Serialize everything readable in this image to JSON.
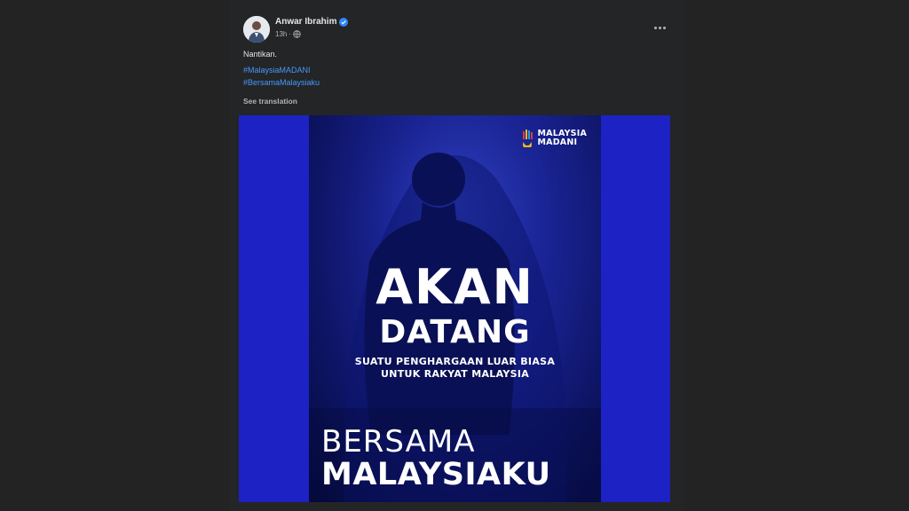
{
  "post": {
    "author": "Anwar Ibrahim",
    "time": "13h",
    "separator": "·",
    "text": "Nantikan.",
    "hashtags": [
      "#MalaysiaMADANI",
      "#BersamaMalaysiaku"
    ],
    "see_translation": "See translation",
    "icons": {
      "verified": "verified-badge-icon",
      "audience": "globe-icon",
      "more": "more-options-icon"
    },
    "colors": {
      "background": "#242526",
      "link": "#4599ff",
      "verified": "#2d88ff",
      "image_bg": "#1d22c4"
    }
  },
  "poster": {
    "logo_line1": "MALAYSIA",
    "logo_line2": "MADANI",
    "headline_line1": "AKAN",
    "headline_line2": "DATANG",
    "sub_line1": "SUATU PENGHARGAAN LUAR BIASA",
    "sub_line2": "UNTUK RAKYAT MALAYSIA",
    "bottom_line1": "BERSAMA",
    "bottom_line2": "MALAYSIAKU"
  }
}
